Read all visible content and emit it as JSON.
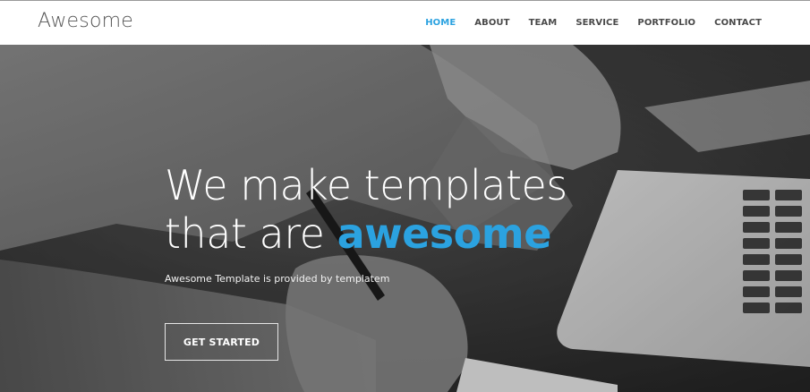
{
  "header": {
    "logo": "Awesome",
    "nav": [
      {
        "label": "HOME",
        "active": true
      },
      {
        "label": "ABOUT",
        "active": false
      },
      {
        "label": "TEAM",
        "active": false
      },
      {
        "label": "SERVICE",
        "active": false
      },
      {
        "label": "PORTFOLIO",
        "active": false
      },
      {
        "label": "CONTACT",
        "active": false
      }
    ]
  },
  "hero": {
    "title_line1": "We make templates",
    "title_line2_prefix": "that are ",
    "title_accent": "awesome",
    "subtitle": "Awesome Template is provided by templatem",
    "cta_label": "GET STARTED",
    "background": "black-and-white photo: hands writing with a pen next to a laptop"
  },
  "colors": {
    "accent": "#2ba2e0",
    "nav_text": "#4a4a4a",
    "header_bg": "#ffffff"
  }
}
